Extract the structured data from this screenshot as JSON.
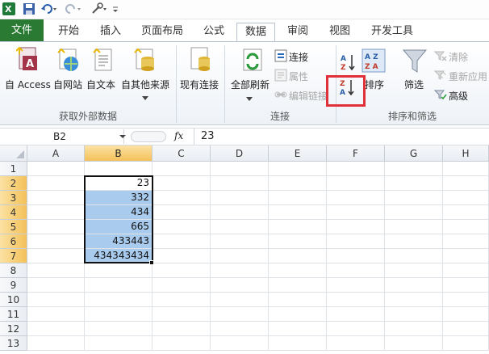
{
  "ribbon_tabs": {
    "file": "文件",
    "home": "开始",
    "insert": "插入",
    "layout": "页面布局",
    "formulas": "公式",
    "data": "数据",
    "review": "审阅",
    "view": "视图",
    "developer": "开发工具"
  },
  "groups": {
    "external": {
      "label": "获取外部数据",
      "access": "自 Access",
      "web": "自网站",
      "text": "自文本",
      "other": "自其他来源"
    },
    "existing": "现有连接",
    "connections": {
      "label": "连接",
      "refresh_all": "全部刷新",
      "connections": "连接",
      "properties": "属性",
      "edit_links": "编辑链接"
    },
    "sort_filter": {
      "label": "排序和筛选",
      "sort": "排序",
      "filter": "筛选",
      "clear": "清除",
      "reapply": "重新应用",
      "advanced": "高级"
    }
  },
  "formula_bar": {
    "name_box": "B2",
    "fx": "fx",
    "content": "23"
  },
  "columns": [
    "A",
    "B",
    "C",
    "D",
    "E",
    "F",
    "G",
    "H"
  ],
  "rows": [
    "1",
    "2",
    "3",
    "4",
    "5",
    "6",
    "7",
    "8",
    "9",
    "10",
    "11",
    "12",
    "13"
  ],
  "cells_b": [
    "",
    "23",
    "332",
    "434",
    "665",
    "433443",
    "434343434",
    "",
    "",
    "",
    "",
    "",
    ""
  ],
  "accent": "#e0303a",
  "brand_green": "#2b7a34"
}
